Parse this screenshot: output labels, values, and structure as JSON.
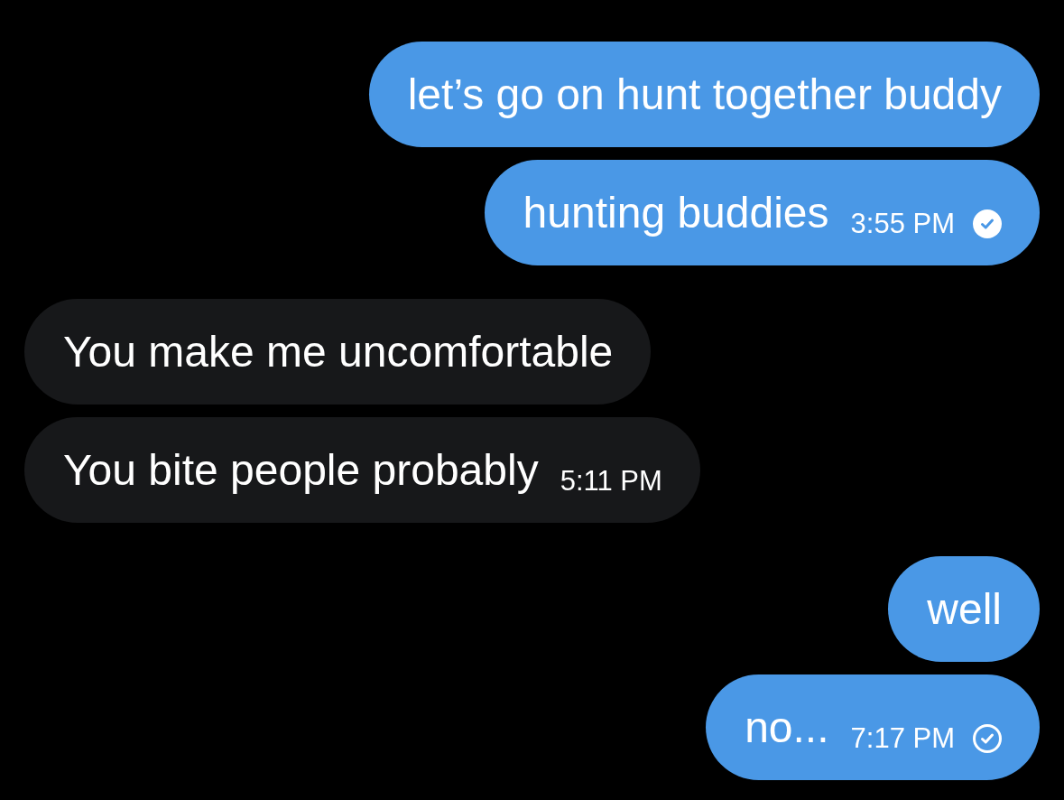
{
  "messages": [
    {
      "outgoing": true,
      "text": "let’s go on hunt together buddy"
    },
    {
      "outgoing": true,
      "text": "hunting buddies",
      "time": "3:55 PM",
      "read": true
    },
    {
      "outgoing": false,
      "text": "You make me uncomfortable"
    },
    {
      "outgoing": false,
      "text": "You bite people probably",
      "time": "5:11 PM"
    },
    {
      "outgoing": true,
      "text": "well"
    },
    {
      "outgoing": true,
      "text": "no...",
      "time": "7:17 PM",
      "read": false
    }
  ]
}
